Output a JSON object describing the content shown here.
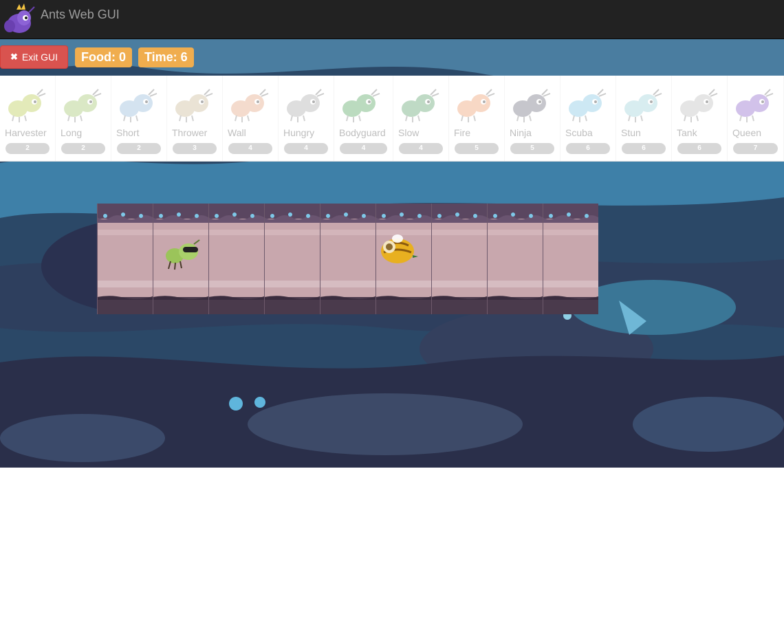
{
  "header": {
    "title": "Ants Web GUI",
    "logo_icon": "queen-ant-logo-icon"
  },
  "controls": {
    "exit_label": "Exit GUI",
    "exit_icon": "close-icon",
    "food_label": "Food: 0",
    "time_label": "Time: 6"
  },
  "ants": [
    {
      "name": "Harvester",
      "cost": "2",
      "color": "#b7c94a"
    },
    {
      "name": "Long",
      "cost": "2",
      "color": "#9fc46a"
    },
    {
      "name": "Short",
      "cost": "2",
      "color": "#8fb6d8"
    },
    {
      "name": "Thrower",
      "cost": "3",
      "color": "#c9b892"
    },
    {
      "name": "Wall",
      "cost": "4",
      "color": "#e3a27e"
    },
    {
      "name": "Hungry",
      "cost": "4",
      "color": "#a9a9a9"
    },
    {
      "name": "Bodyguard",
      "cost": "4",
      "color": "#4fa35a"
    },
    {
      "name": "Slow",
      "cost": "4",
      "color": "#5aa06a"
    },
    {
      "name": "Fire",
      "cost": "5",
      "color": "#ee9a6a"
    },
    {
      "name": "Ninja",
      "cost": "5",
      "color": "#6c6c7c"
    },
    {
      "name": "Scuba",
      "cost": "6",
      "color": "#7ec4e3"
    },
    {
      "name": "Stun",
      "cost": "6",
      "color": "#9bd0d8"
    },
    {
      "name": "Tank",
      "cost": "6",
      "color": "#bdbdbd"
    },
    {
      "name": "Queen",
      "cost": "7",
      "color": "#8a62c9"
    }
  ],
  "board": {
    "place_count": 9,
    "placed_ant": {
      "type": "Short",
      "place_index": 1,
      "icon": "short-ant-with-sunglasses-icon"
    },
    "bee": {
      "place_index": 5,
      "icon": "bee-icon"
    }
  }
}
